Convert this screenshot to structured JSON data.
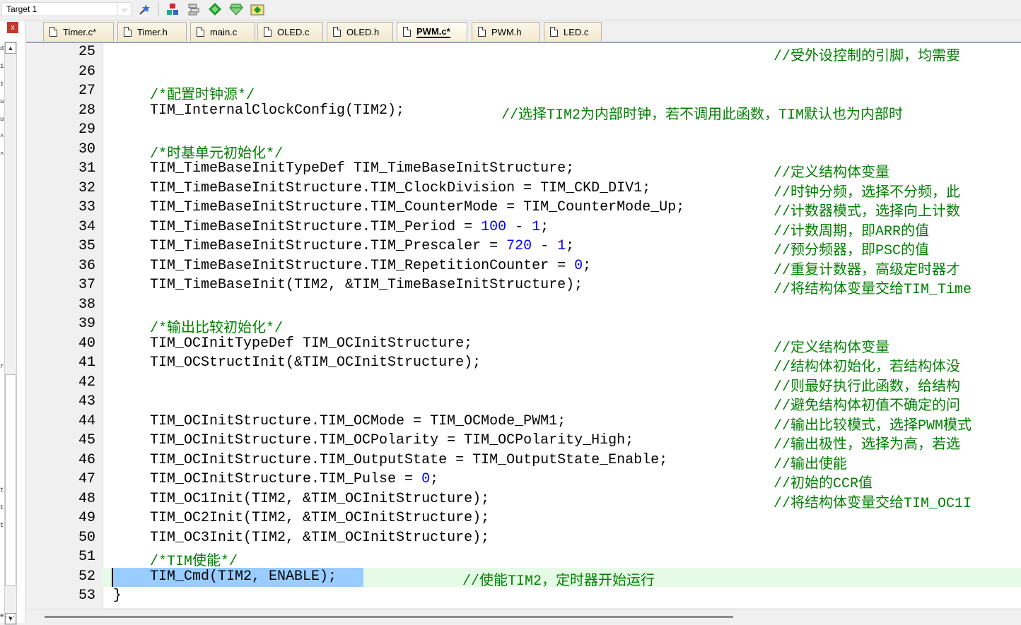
{
  "toolbar": {
    "target_label": "Target 1",
    "icons": [
      "options-for-target-icon",
      "manage-components-icon",
      "file-extensions-icon",
      "select-packs-icon",
      "pack-installer-icon",
      "rte-config-icon"
    ]
  },
  "left_panel": {
    "close_glyph": "x",
    "glyphs": [
      "d",
      "i",
      "i",
      "u",
      "u",
      "^",
      "^",
      "r",
      "t",
      "t",
      "t",
      "e..."
    ]
  },
  "tabs": [
    {
      "label": "Timer.c*",
      "active": false
    },
    {
      "label": "Timer.h",
      "active": false
    },
    {
      "label": "main.c",
      "active": false
    },
    {
      "label": "OLED.c",
      "active": false
    },
    {
      "label": "OLED.h",
      "active": false
    },
    {
      "label": "PWM.c*",
      "active": true
    },
    {
      "label": "PWM.h",
      "active": false
    },
    {
      "label": "LED.c",
      "active": false
    }
  ],
  "editor": {
    "lines": [
      {
        "n": "25",
        "code": "",
        "comment": "//受外设控制的引脚，均需要"
      },
      {
        "n": "26",
        "code": "",
        "comment": ""
      },
      {
        "n": "27",
        "code": "",
        "comment": "",
        "block_comment": "/*配置时钟源*/"
      },
      {
        "n": "28",
        "code": "TIM_InternalClockConfig(TIM2);",
        "comment": "//选择TIM2为内部时钟，若不调用此函数，TIM默认也为内部时"
      },
      {
        "n": "29",
        "code": "",
        "comment": ""
      },
      {
        "n": "30",
        "code": "",
        "comment": "",
        "block_comment": "/*时基单元初始化*/"
      },
      {
        "n": "31",
        "code": "TIM_TimeBaseInitTypeDef TIM_TimeBaseInitStructure;",
        "comment": "//定义结构体变量"
      },
      {
        "n": "32",
        "code": "TIM_TimeBaseInitStructure.TIM_ClockDivision = TIM_CKD_DIV1;",
        "comment": "//时钟分频，选择不分频，此"
      },
      {
        "n": "33",
        "code": "TIM_TimeBaseInitStructure.TIM_CounterMode = TIM_CounterMode_Up;",
        "comment": "//计数器模式，选择向上计数"
      },
      {
        "n": "34",
        "code_pre": "TIM_TimeBaseInitStructure.TIM_Period = ",
        "num1": "100",
        "mid": " - ",
        "num2": "1",
        "post": ";",
        "comment": "//计数周期，即ARR的值"
      },
      {
        "n": "35",
        "code_pre": "TIM_TimeBaseInitStructure.TIM_Prescaler = ",
        "num1": "720",
        "mid": " - ",
        "num2": "1",
        "post": ";",
        "comment": "//预分频器，即PSC的值"
      },
      {
        "n": "36",
        "code_pre": "TIM_TimeBaseInitStructure.TIM_RepetitionCounter = ",
        "num1": "0",
        "post": ";",
        "comment": "//重复计数器，高级定时器才"
      },
      {
        "n": "37",
        "code": "TIM_TimeBaseInit(TIM2, &TIM_TimeBaseInitStructure);",
        "comment": "//将结构体变量交给TIM_Time"
      },
      {
        "n": "38",
        "code": "",
        "comment": ""
      },
      {
        "n": "39",
        "code": "",
        "comment": "",
        "block_comment": "/*输出比较初始化*/"
      },
      {
        "n": "40",
        "code": "TIM_OCInitTypeDef TIM_OCInitStructure;",
        "comment": "//定义结构体变量"
      },
      {
        "n": "41",
        "code": "TIM_OCStructInit(&TIM_OCInitStructure);",
        "comment": "//结构体初始化，若结构体没"
      },
      {
        "n": "42",
        "code": "",
        "comment": "//则最好执行此函数，给结构"
      },
      {
        "n": "43",
        "code": "",
        "comment": "//避免结构体初值不确定的问"
      },
      {
        "n": "44",
        "code": "TIM_OCInitStructure.TIM_OCMode = TIM_OCMode_PWM1;",
        "comment": "//输出比较模式，选择PWM模式"
      },
      {
        "n": "45",
        "code": "TIM_OCInitStructure.TIM_OCPolarity = TIM_OCPolarity_High;",
        "comment": "//输出极性，选择为高，若选"
      },
      {
        "n": "46",
        "code": "TIM_OCInitStructure.TIM_OutputState = TIM_OutputState_Enable;",
        "comment": "//输出使能"
      },
      {
        "n": "47",
        "code_pre": "TIM_OCInitStructure.TIM_Pulse = ",
        "num1": "0",
        "post": ";",
        "comment": "//初始的CCR值"
      },
      {
        "n": "48",
        "code": "TIM_OC1Init(TIM2, &TIM_OCInitStructure);",
        "comment": "//将结构体变量交给TIM_OC1I"
      },
      {
        "n": "49",
        "code": "TIM_OC2Init(TIM2, &TIM_OCInitStructure);",
        "comment": ""
      },
      {
        "n": "50",
        "code": "TIM_OC3Init(TIM2, &TIM_OCInitStructure);",
        "comment": ""
      },
      {
        "n": "51",
        "code": "",
        "comment": "",
        "block_comment": "/*TIM使能*/"
      },
      {
        "n": "52",
        "code": "TIM_Cmd(TIM2, ENABLE);",
        "comment": "//使能TIM2，定时器开始运行",
        "selected": true
      },
      {
        "n": "53",
        "code": "",
        "comment": "",
        "brace": "}"
      }
    ]
  },
  "colors": {
    "comment": "#008000",
    "number": "#0000ff",
    "selection": "#99ccff",
    "current_line": "#e6fbe6"
  }
}
